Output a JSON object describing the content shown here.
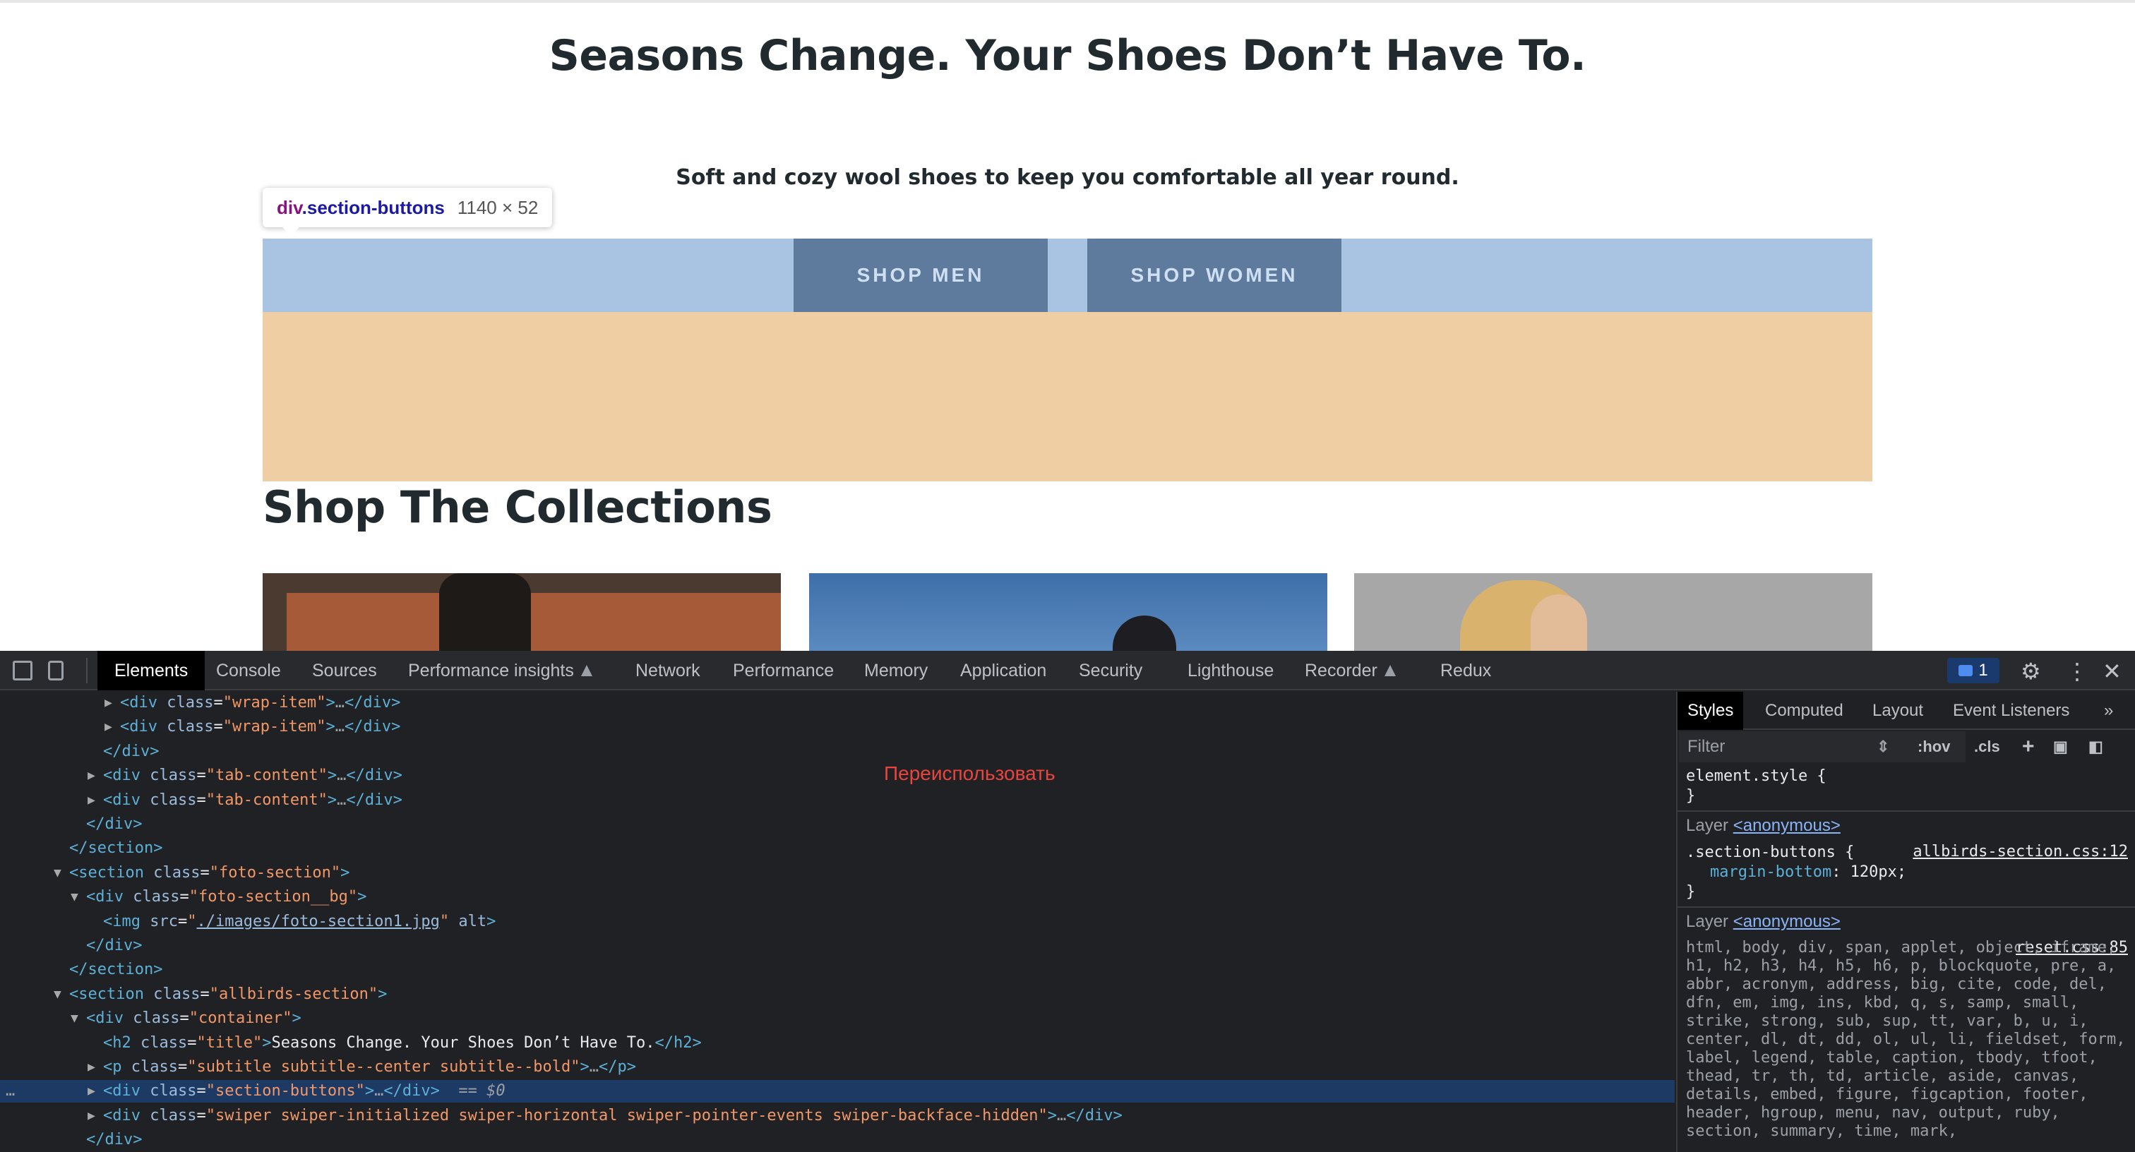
{
  "page": {
    "title": "Seasons Change. Your Shoes Don’t Have To.",
    "subtitle": "Soft and cozy wool shoes to keep you comfortable all year round.",
    "inspect_tooltip": {
      "tag": "div",
      "class_name": ".section-buttons",
      "size": "1140 × 52"
    },
    "buttons": [
      "SHOP MEN",
      "SHOP WOMEN"
    ],
    "collections_title": "Shop The Collections"
  },
  "devtools": {
    "tabs": [
      "Elements",
      "Console",
      "Sources",
      "Performance insights",
      "Network",
      "Performance",
      "Memory",
      "Application",
      "Security",
      "Lighthouse",
      "Recorder",
      "Redux"
    ],
    "active_tab": "Elements",
    "issues_count": "1",
    "dom_lines": [
      {
        "indent": 5,
        "tog": "▶",
        "html": "<div class=\"wrap-item\">…</div>"
      },
      {
        "indent": 5,
        "tog": "▶",
        "html": "<div class=\"wrap-item\">…</div>"
      },
      {
        "indent": 4,
        "tog": "",
        "html": "</div>"
      },
      {
        "indent": 4,
        "tog": "▶",
        "html": "<div class=\"tab-content\">…</div>"
      },
      {
        "indent": 4,
        "tog": "▶",
        "html": "<div class=\"tab-content\">…</div>"
      },
      {
        "indent": 3,
        "tog": "",
        "html": "</div>"
      },
      {
        "indent": 2,
        "tog": "",
        "html": "</section>"
      },
      {
        "indent": 2,
        "tog": "▼",
        "html": "<section class=\"foto-section\">"
      },
      {
        "indent": 3,
        "tog": "▼",
        "html": "<div class=\"foto-section__bg\">"
      },
      {
        "indent": 4,
        "tog": "",
        "html": "<img src=\"./images/foto-section1.jpg\" alt>"
      },
      {
        "indent": 3,
        "tog": "",
        "html": "</div>"
      },
      {
        "indent": 2,
        "tog": "",
        "html": "</section>"
      },
      {
        "indent": 2,
        "tog": "▼",
        "html": "<section class=\"allbirds-section\">"
      },
      {
        "indent": 3,
        "tog": "▼",
        "html": "<div class=\"container\">"
      },
      {
        "indent": 4,
        "tog": "",
        "html": "<h2 class=\"title\">Seasons Change. Your Shoes Don’t Have To.</h2>"
      },
      {
        "indent": 4,
        "tog": "▶",
        "html": "<p class=\"subtitle subtitle--center subtitle--bold\">…</p>"
      },
      {
        "indent": 4,
        "tog": "▶",
        "html": "<div class=\"section-buttons\">…</div> == $0",
        "selected": true
      },
      {
        "indent": 4,
        "tog": "▶",
        "html": "<div class=\"swiper swiper-initialized swiper-horizontal swiper-pointer-events swiper-backface-hidden\">…</div>"
      },
      {
        "indent": 3,
        "tog": "",
        "html": "</div>"
      }
    ],
    "overlay_note": "Переиспользовать",
    "styles": {
      "tabs": [
        "Styles",
        "Computed",
        "Layout",
        "Event Listeners"
      ],
      "filter_placeholder": "Filter",
      "hov": ":hov",
      "cls": ".cls",
      "element_style": "element.style {",
      "close_brace": "}",
      "layer_label": "Layer",
      "layer_name": "<anonymous>",
      "rule1_selector": ".section-buttons {",
      "rule1_file": "allbirds-section.css:12",
      "rule1_prop": "margin-bottom",
      "rule1_value": ": 120px;",
      "rule2_file": "reset.css:85",
      "rule2_selectors": "html, body, div, span, applet, object, iframe, h1, h2, h3, h4, h5, h6, p, blockquote, pre, a, abbr, acronym, address, big, cite, code, del, dfn, em, img, ins, kbd, q, s, samp, small, strike, strong, sub, sup, tt, var, b, u, i, center, dl, dt, dd, ol, ul, li, fieldset, form, label, legend, table, caption, tbody, tfoot, thead, tr, th, td, article, aside, canvas, details, embed, figure, figcaption, footer, header, hgroup, menu, nav, output, ruby, section, summary, time, mark,"
    }
  },
  "colors": {
    "highlight_content": "#a8c4e2",
    "highlight_margin": "#f0cea4",
    "button_bg": "#5e7b9e",
    "devtools_bg": "#202124",
    "selected_row": "#1c3a63"
  }
}
